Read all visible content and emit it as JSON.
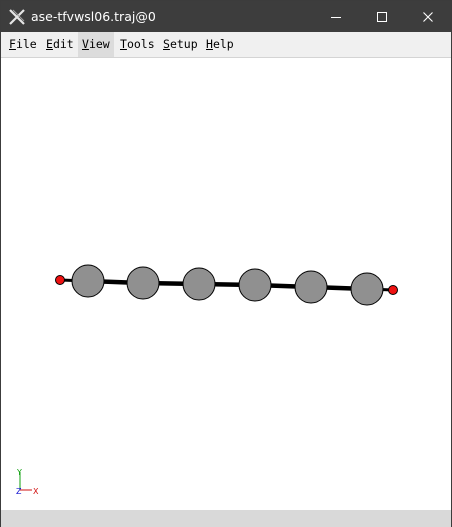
{
  "window": {
    "title": "ase-tfvwsl06.traj@0"
  },
  "menu": {
    "items": [
      {
        "label_u": "F",
        "label_rest": "ile"
      },
      {
        "label_u": "E",
        "label_rest": "dit"
      },
      {
        "label_u": "V",
        "label_rest": "iew"
      },
      {
        "label_u": "T",
        "label_rest": "ools"
      },
      {
        "label_u": "S",
        "label_rest": "etup"
      },
      {
        "label_u": "H",
        "label_rest": "elp"
      }
    ],
    "active_index": 2
  },
  "molecule": {
    "atoms": [
      {
        "element": "O",
        "color": "#ee1111"
      },
      {
        "element": "C",
        "color": "#909090"
      },
      {
        "element": "C",
        "color": "#909090"
      },
      {
        "element": "C",
        "color": "#909090"
      },
      {
        "element": "C",
        "color": "#909090"
      },
      {
        "element": "C",
        "color": "#909090"
      },
      {
        "element": "C",
        "color": "#909090"
      },
      {
        "element": "O",
        "color": "#ee1111"
      }
    ],
    "bond_color": "#000000"
  },
  "axes": {
    "x_label": "X",
    "x_color": "#d01010",
    "y_label": "Y",
    "y_color": "#10a010",
    "z_label": "Z",
    "z_color": "#1010d0"
  },
  "status": {
    "text": ""
  }
}
